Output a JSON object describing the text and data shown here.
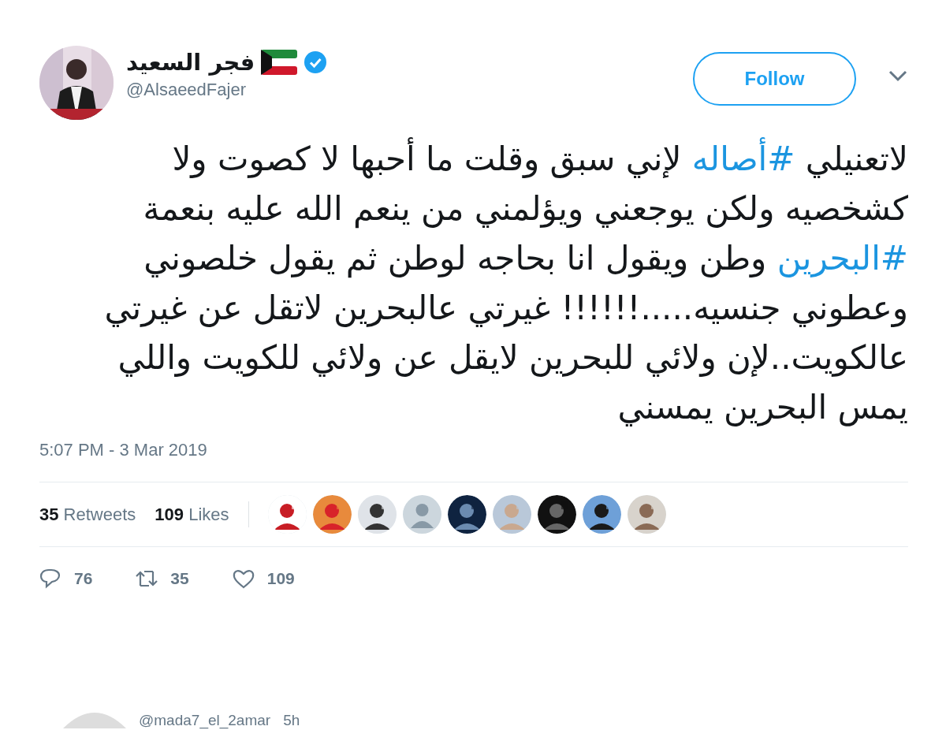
{
  "author": {
    "name": "فجر السعيد",
    "handle": "@AlsaeedFajer",
    "verified": true
  },
  "follow_button": {
    "label": "Follow"
  },
  "tweet": {
    "segments": [
      {
        "kind": "text",
        "text": "لاتعنيلي "
      },
      {
        "kind": "hashtag",
        "text": "#أصاله"
      },
      {
        "kind": "text",
        "text": " لإني سبق وقلت ما أحبها لا كصوت ولا كشخصيه ولكن يوجعني ويؤلمني من ينعم الله عليه بنعمة "
      },
      {
        "kind": "hashtag",
        "text": "#البحرين"
      },
      {
        "kind": "text",
        "text": " وطن ويقول انا بحاجه لوطن ثم يقول خلصوني وعطوني جنسيه.....!!!!!! غيرتي عالبحرين لاتقل عن غيرتي عالكويت..لإن ولائي للبحرين لايقل عن ولائي للكويت واللي يمس البحرين يمسني"
      }
    ]
  },
  "timestamp": "5:07 PM - 3 Mar 2019",
  "stats": {
    "retweets": {
      "count": "35",
      "label": "Retweets"
    },
    "likes": {
      "count": "109",
      "label": "Likes"
    }
  },
  "likers": [
    {
      "kind": "picture"
    },
    {
      "kind": "picture"
    },
    {
      "kind": "picture"
    },
    {
      "kind": "default"
    },
    {
      "kind": "picture"
    },
    {
      "kind": "picture"
    },
    {
      "kind": "picture"
    },
    {
      "kind": "picture"
    },
    {
      "kind": "picture"
    }
  ],
  "actions": {
    "reply": {
      "count": "76"
    },
    "retweet": {
      "count": "35"
    },
    "like": {
      "count": "109"
    }
  },
  "reply_preview": {
    "handle": "@mada7_el_2amar",
    "time": "5h"
  }
}
